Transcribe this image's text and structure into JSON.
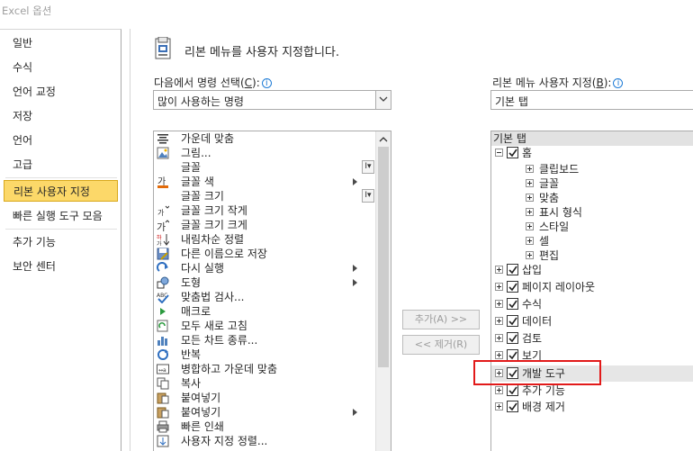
{
  "window": {
    "title": "Excel 옵션"
  },
  "sidebar": {
    "items": [
      {
        "label": "일반"
      },
      {
        "label": "수식"
      },
      {
        "label": "언어 교정"
      },
      {
        "label": "저장"
      },
      {
        "label": "언어"
      },
      {
        "label": "고급"
      },
      {
        "label": "리본 사용자 지정",
        "selected": true
      },
      {
        "label": "빠른 실행 도구 모음"
      },
      {
        "label": "추가 기능"
      },
      {
        "label": "보안 센터"
      }
    ]
  },
  "header": {
    "title": "리본 메뉴를 사용자 지정합니다."
  },
  "left_panel": {
    "label": "다음에서 명령 선택(",
    "accel": "C",
    "label_tail": "):",
    "dropdown_value": "많이 사용하는 명령",
    "commands": [
      {
        "label": "가운데 맞춤",
        "icon": "align-center-icon"
      },
      {
        "label": "그림...",
        "icon": "picture-icon"
      },
      {
        "label": "글꼴",
        "icon": "none",
        "font_box": true
      },
      {
        "label": "글꼴 색",
        "icon": "font-color-icon",
        "submenu": true
      },
      {
        "label": "글꼴 크기",
        "icon": "none",
        "font_box": true
      },
      {
        "label": "글꼴 크기 작게",
        "icon": "shrink-font-icon"
      },
      {
        "label": "글꼴 크기 크게",
        "icon": "grow-font-icon"
      },
      {
        "label": "내림차순 정렬",
        "icon": "sort-descending-icon"
      },
      {
        "label": "다른 이름으로 저장",
        "icon": "save-as-icon"
      },
      {
        "label": "다시 실행",
        "icon": "redo-icon",
        "submenu": true
      },
      {
        "label": "도형",
        "icon": "shapes-icon",
        "submenu": true
      },
      {
        "label": "맞춤법 검사...",
        "icon": "spelling-icon"
      },
      {
        "label": "매크로",
        "icon": "macro-icon"
      },
      {
        "label": "모두 새로 고침",
        "icon": "refresh-all-icon"
      },
      {
        "label": "모든 차트 종류...",
        "icon": "chart-icon"
      },
      {
        "label": "반복",
        "icon": "repeat-icon"
      },
      {
        "label": "병합하고 가운데 맞춤",
        "icon": "merge-center-icon"
      },
      {
        "label": "복사",
        "icon": "copy-icon"
      },
      {
        "label": "붙여넣기",
        "icon": "paste-icon"
      },
      {
        "label": "붙여넣기",
        "icon": "paste-icon",
        "submenu": true
      },
      {
        "label": "빠른 인쇄",
        "icon": "quick-print-icon"
      },
      {
        "label": "사용자 지정 정렬...",
        "icon": "custom-sort-icon"
      }
    ]
  },
  "buttons": {
    "add": "추가(A) >>",
    "remove": "<< 제거(R)"
  },
  "right_panel": {
    "label": "리본 메뉴 사용자 지정(",
    "accel": "B",
    "label_tail": "):",
    "dropdown_value": "기본 탭",
    "tree_header": "기본 탭",
    "tree": [
      {
        "label": "홈",
        "level": 0,
        "expanded": true,
        "checked": true
      },
      {
        "label": "클립보드",
        "level": 1
      },
      {
        "label": "글꼴",
        "level": 1
      },
      {
        "label": "맞춤",
        "level": 1
      },
      {
        "label": "표시 형식",
        "level": 1
      },
      {
        "label": "스타일",
        "level": 1
      },
      {
        "label": "셀",
        "level": 1
      },
      {
        "label": "편집",
        "level": 1
      },
      {
        "label": "삽입",
        "level": 0,
        "checked": true
      },
      {
        "label": "페이지 레이아웃",
        "level": 0,
        "checked": true
      },
      {
        "label": "수식",
        "level": 0,
        "checked": true
      },
      {
        "label": "데이터",
        "level": 0,
        "checked": true
      },
      {
        "label": "검토",
        "level": 0,
        "checked": true
      },
      {
        "label": "보기",
        "level": 0,
        "checked": true
      },
      {
        "label": "개발 도구",
        "level": 0,
        "checked": true,
        "highlighted": true
      },
      {
        "label": "추가 기능",
        "level": 0,
        "checked": true
      },
      {
        "label": "배경 제거",
        "level": 0,
        "checked": true
      }
    ]
  },
  "colors": {
    "selected_nav": "#fcd869",
    "highlight_box": "#e21a1a"
  }
}
